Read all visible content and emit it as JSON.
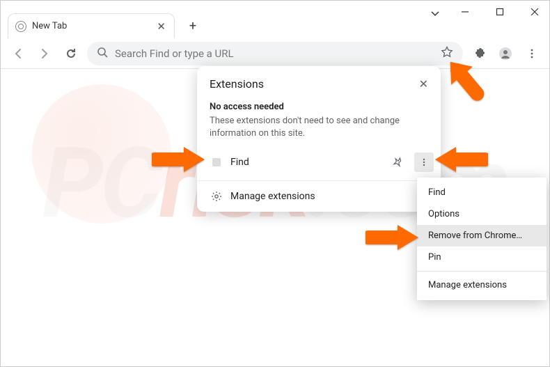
{
  "window": {
    "tab_title": "New Tab"
  },
  "toolbar": {
    "omnibox_placeholder": "Search Find or type a URL"
  },
  "extensions_popup": {
    "title": "Extensions",
    "section_title": "No access needed",
    "section_desc": "These extensions don't need to see and change information on this site.",
    "extension_name": "Find",
    "manage_label": "Manage extensions"
  },
  "submenu": {
    "items": [
      "Find",
      "Options",
      "Remove from Chrome…",
      "Pin",
      "Manage extensions"
    ],
    "highlighted_index": 2
  },
  "watermark": {
    "text_plain": "PC",
    "text_accent": "risk",
    "text_suffix": ".com"
  }
}
